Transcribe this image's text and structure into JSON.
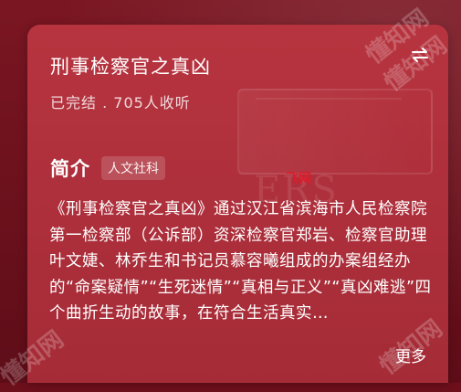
{
  "book": {
    "title": "刑事检察官之真凶",
    "meta": "已完结 . 705人收听"
  },
  "intro": {
    "heading": "简介",
    "tag": "人文社科",
    "description": "《刑事检察官之真凶》通过汉江省滨海市人民检察院第一检察部（公诉部）资深检察官郑岩、检察官助理叶文婕、林乔生和书记员慕容曦组成的办案组经办的“命案疑情”“生死迷情”“真相与正义”“真凶难逃”四个曲折生动的故事，在符合生活真实…",
    "more_label": "更多"
  },
  "icons": {
    "swap": "swap-arrows-icon"
  },
  "background_text": {
    "letters": "ERS",
    "red_mark": "飞网"
  },
  "watermarks": [
    "懂知网",
    "懂知网",
    "懂知网",
    "懂知网"
  ],
  "colors": {
    "card": "#ac2f3b",
    "page": "#6e0f1c",
    "text": "#ffffff"
  }
}
